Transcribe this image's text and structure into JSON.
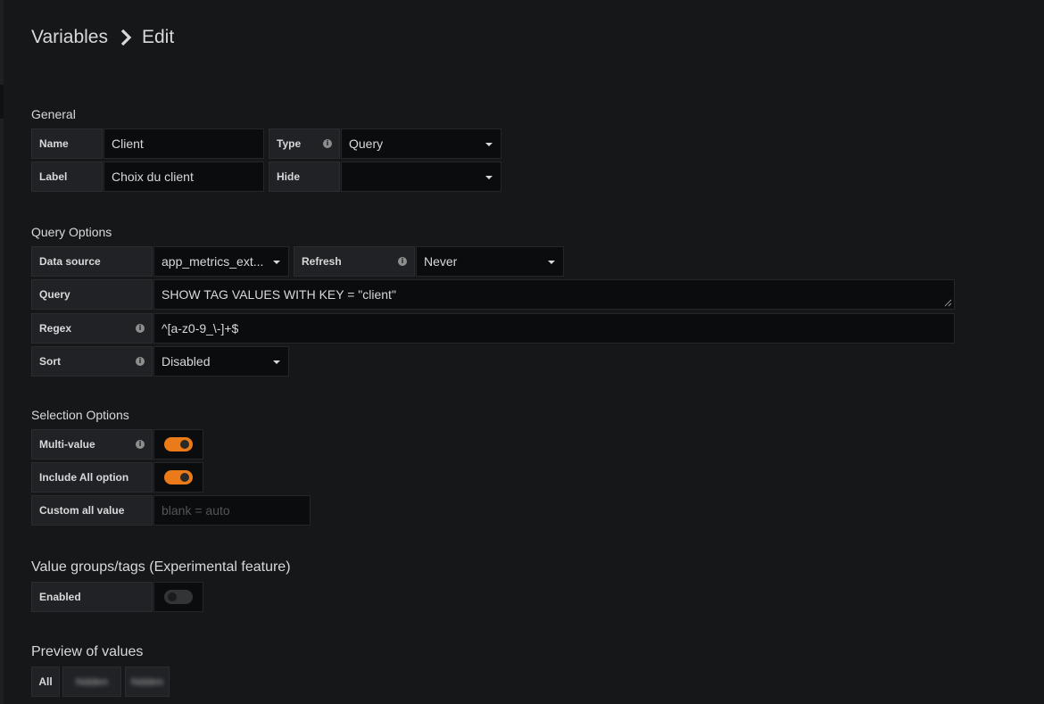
{
  "breadcrumb": {
    "parent": "Variables",
    "current": "Edit"
  },
  "general": {
    "title": "General",
    "name_label": "Name",
    "name_value": "Client",
    "type_label": "Type",
    "type_value": "Query",
    "label_label": "Label",
    "label_value": "Choix du client",
    "hide_label": "Hide",
    "hide_value": ""
  },
  "query_options": {
    "title": "Query Options",
    "datasource_label": "Data source",
    "datasource_value": "app_metrics_ext...",
    "refresh_label": "Refresh",
    "refresh_value": "Never",
    "query_label": "Query",
    "query_value": "SHOW TAG VALUES WITH KEY = \"client\"",
    "regex_label": "Regex",
    "regex_value": "^[a-z0-9_\\-]+$",
    "sort_label": "Sort",
    "sort_value": "Disabled"
  },
  "selection_options": {
    "title": "Selection Options",
    "multi_label": "Multi-value",
    "multi_on": true,
    "includeall_label": "Include All option",
    "includeall_on": true,
    "customall_label": "Custom all value",
    "customall_placeholder": "blank = auto"
  },
  "value_groups": {
    "title": "Value groups/tags (Experimental feature)",
    "enabled_label": "Enabled",
    "enabled_on": false
  },
  "preview": {
    "title": "Preview of values",
    "values": [
      "All",
      "hidden",
      "hidden"
    ]
  },
  "colors": {
    "accent": "#eb7b18",
    "background": "#161719",
    "input_bg": "#0b0c0e",
    "label_bg": "#202226"
  },
  "icons": {
    "breadcrumb_separator": "chevron-right-icon",
    "info": "info-icon",
    "dropdown": "caret-down-icon"
  }
}
